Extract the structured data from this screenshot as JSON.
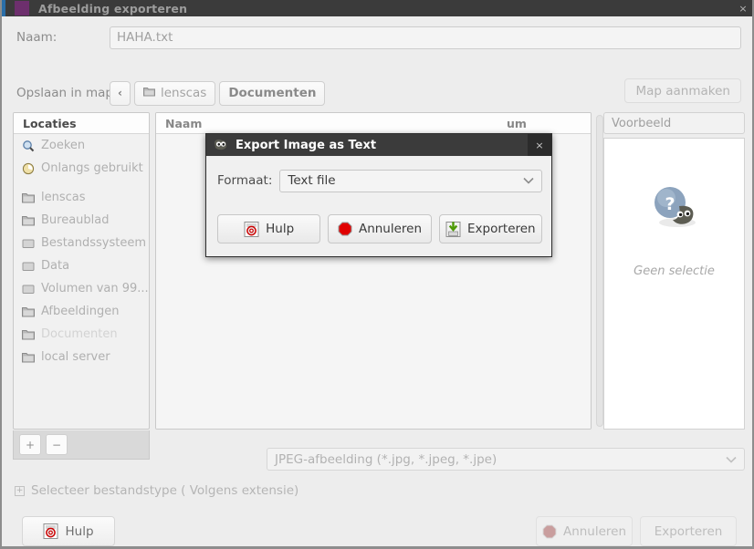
{
  "window": {
    "title": "Afbeelding exporteren",
    "close_label": "×",
    "app_icon": "gimp-app-icon"
  },
  "form": {
    "name_label": "Naam:",
    "name_value": "HAHA.txt",
    "name_placeholder": "HAHA.txt",
    "folder_label": "Opslaan in map:",
    "breadcrumb_back": "‹",
    "breadcrumbs": [
      {
        "label": "lenscas",
        "active": false,
        "icon": "folder-icon"
      },
      {
        "label": "Documenten",
        "active": true,
        "icon": ""
      }
    ],
    "new_folder_label": "Map aanmaken"
  },
  "sidebar": {
    "header": "Locaties",
    "items": [
      {
        "label": "Zoeken",
        "icon": "search-icon",
        "selected": false
      },
      {
        "label": "Onlangs gebruikt",
        "icon": "recent-icon",
        "selected": false
      },
      {
        "label": "lenscas",
        "icon": "folder-icon",
        "selected": false
      },
      {
        "label": "Bureaublad",
        "icon": "folder-icon",
        "selected": false
      },
      {
        "label": "Bestandssysteem",
        "icon": "drive-icon",
        "selected": false
      },
      {
        "label": "Data",
        "icon": "drive-icon",
        "selected": false
      },
      {
        "label": "Volumen van 99...",
        "icon": "drive-icon",
        "selected": false
      },
      {
        "label": "Afbeeldingen",
        "icon": "folder-icon",
        "selected": false
      },
      {
        "label": "Documenten",
        "icon": "folder-icon",
        "selected": true
      },
      {
        "label": "local server",
        "icon": "folder-icon",
        "selected": false
      }
    ],
    "add_label": "+",
    "remove_label": "−"
  },
  "filelist": {
    "columns": [
      "Naam",
      "um"
    ],
    "rows": []
  },
  "preview": {
    "header": "Voorbeeld",
    "icon": "wilber-question-icon",
    "empty_text": "Geen selectie"
  },
  "filter": {
    "value": "JPEG-afbeelding (*.jpg, *.jpeg, *.jpe)",
    "chevron": "∨"
  },
  "expander": {
    "toggle": "+",
    "label": "Selecteer bestandstype ( Volgens extensie)"
  },
  "actions": {
    "help_label": "Hulp",
    "help_icon": "help-lifebuoy-icon",
    "cancel_label": "Annuleren",
    "cancel_icon": "stop-octagon-icon",
    "cancel_disabled": true,
    "export_label": "Exporteren",
    "export_disabled": true
  },
  "modal": {
    "title": "Export Image as Text",
    "icon": "wilber-icon",
    "close_label": "×",
    "format_label": "Formaat:",
    "format_value": "Text file",
    "chevron": "∨",
    "buttons": [
      {
        "label": "Hulp",
        "icon": "help-lifebuoy-icon"
      },
      {
        "label": "Annuleren",
        "icon": "stop-octagon-icon"
      },
      {
        "label": "Exporteren",
        "icon": "export-download-icon"
      }
    ]
  },
  "colors": {
    "titlebar_bg": "#3b3b3b",
    "app_accent": "#6d2f6d",
    "window_bg": "#ededed",
    "stop_red": "#cc0000",
    "export_green": "#4e9a06"
  }
}
